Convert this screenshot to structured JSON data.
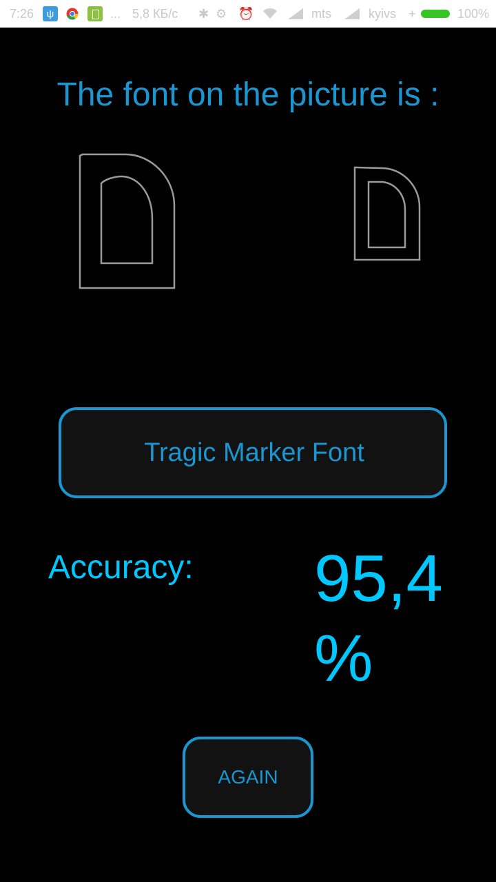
{
  "status_bar": {
    "time": "7:26",
    "usb_icon": "usb-icon",
    "chrome_icon": "chrome-icon",
    "notification_icon": "battery-notification-icon",
    "more_dots": "...",
    "network_speed": "5,8 КБ/с",
    "bluetooth": "✱",
    "alarm": "⏰",
    "operator1": "mts",
    "operator2": "kyivs",
    "plus": "+",
    "battery_percent": "100%",
    "battery_color": "#37c425"
  },
  "result": {
    "title": "The font on the picture is :",
    "font_name": "Tragic Marker Font",
    "accuracy_label": "Accuracy:",
    "accuracy_value": "95,4 %",
    "again_button": "AGAIN"
  },
  "colors": {
    "accent": "#1a96d0",
    "accuracy": "#00c8ff",
    "background": "#000000",
    "glyph_stroke": "#9a9a9a"
  }
}
